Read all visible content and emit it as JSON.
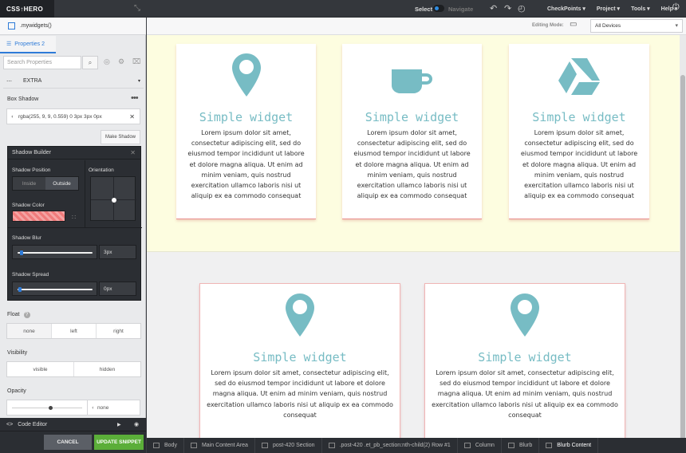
{
  "topbar": {
    "logo": "CSS↑HERO",
    "select_label": "Select",
    "navigate_label": "Navigate",
    "menus": [
      "CheckPoints ▾",
      "Project ▾",
      "Tools ▾",
      "Help ▾"
    ]
  },
  "panel": {
    "selector": ".mywidgets()",
    "properties_tab": "Properties 2",
    "search_placeholder": "Search Properties",
    "extra_label": "EXTRA",
    "box_shadow": {
      "title": "Box Shadow",
      "value": "rgba(255, 9, 9, 0.559) 0 3px 3px 0px",
      "make_shadow": "Make Shadow"
    },
    "shadow_builder": {
      "title": "Shadow Builder",
      "position_label": "Shadow Position",
      "inside": "Inside",
      "outside": "Outside",
      "orientation_label": "Orientation",
      "color_label": "Shadow Color",
      "blur_label": "Shadow Blur",
      "blur_value": "3px",
      "spread_label": "Shadow Spread",
      "spread_value": "0px"
    },
    "float": {
      "title": "Float",
      "options": [
        "none",
        "left",
        "right"
      ]
    },
    "visibility": {
      "title": "Visibility",
      "options": [
        "visible",
        "hidden"
      ]
    },
    "opacity": {
      "title": "Opacity",
      "value": "none"
    },
    "code_editor": "Code Editor",
    "cancel": "CANCEL",
    "update": "UPDATE SNIPPET"
  },
  "editbar": {
    "label": "Editing Mode:",
    "device": "All Devices"
  },
  "cards": [
    {
      "icon": "location-pin-icon",
      "title": "Simple widget",
      "lines": [
        "Lorem ipsum dolor sit amet,",
        "consectetur adipiscing elit, sed do",
        "eiusmod tempor incididunt ut labore",
        "et dolore magna aliqua. Ut enim ad",
        "minim veniam, quis nostrud",
        "exercitation ullamco laboris nisi ut",
        "aliquip ex ea commodo consequat"
      ]
    },
    {
      "icon": "coffee-cup-icon",
      "title": "Simple widget",
      "lines": [
        "Lorem ipsum dolor sit amet,",
        "consectetur adipiscing elit, sed do",
        "eiusmod tempor incididunt ut labore",
        "et dolore magna aliqua. Ut enim ad",
        "minim veniam, quis nostrud",
        "exercitation ullamco laboris nisi ut",
        "aliquip ex ea commodo consequat"
      ]
    },
    {
      "icon": "google-drive-icon",
      "title": "Simple widget",
      "lines": [
        "Lorem ipsum dolor sit amet,",
        "consectetur adipiscing elit, sed do",
        "eiusmod tempor incididunt ut labore",
        "et dolore magna aliqua. Ut enim ad",
        "minim veniam, quis nostrud",
        "exercitation ullamco laboris nisi ut",
        "aliquip ex ea commodo consequat"
      ]
    },
    {
      "icon": "location-pin-icon",
      "title": "Simple widget",
      "lines": [
        "Lorem ipsum dolor sit amet, consectetur adipiscing elit,",
        "sed do eiusmod tempor incididunt ut labore et dolore",
        "magna aliqua. Ut enim ad minim veniam, quis nostrud",
        "exercitation ullamco laboris nisi ut aliquip ex ea commodo",
        "consequat"
      ]
    },
    {
      "icon": "location-pin-icon",
      "title": "Simple widget",
      "lines": [
        "Lorem ipsum dolor sit amet, consectetur adipiscing elit,",
        "sed do eiusmod tempor incididunt ut labore et dolore",
        "magna aliqua. Ut enim ad minim veniam, quis nostrud",
        "exercitation ullamco laboris nisi ut aliquip ex ea commodo",
        "consequat"
      ]
    }
  ],
  "breadcrumb": [
    "Body",
    "Main Content Area",
    "post-420 Section",
    ".post-420 .et_pb_section:nth-child(2) Row #1",
    "Column",
    "Blurb",
    "Blurb Content"
  ],
  "colors": {
    "accent": "#2e7bd8",
    "icon": "#77bcc4",
    "update": "#5bae39",
    "section_bg": "#fdfde0",
    "shadow": "#f07b7b"
  }
}
